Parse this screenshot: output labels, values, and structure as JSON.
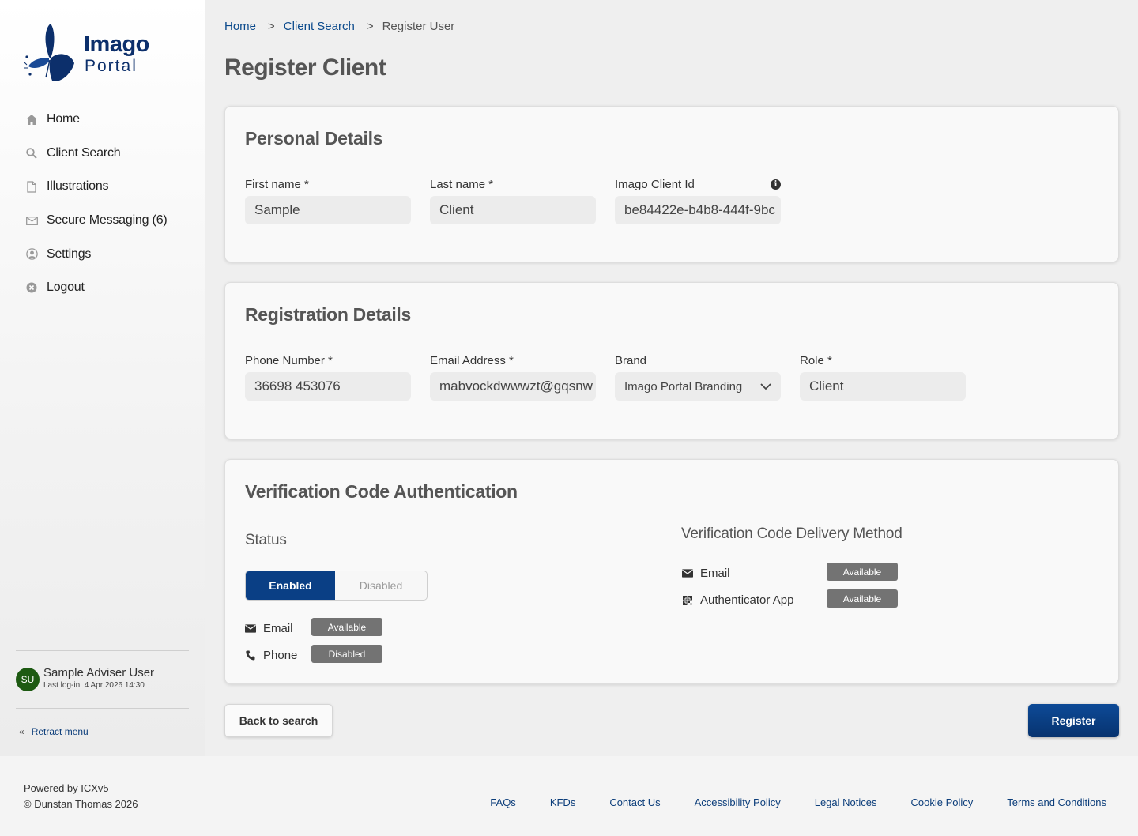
{
  "brand": {
    "name_line1": "Imago",
    "name_line2": "Portal",
    "color": "#0c2f6b"
  },
  "sidebar": {
    "items": [
      {
        "label": "Home",
        "icon": "home-icon"
      },
      {
        "label": "Client Search",
        "icon": "search-icon"
      },
      {
        "label": "Illustrations",
        "icon": "document-icon"
      },
      {
        "label": "Secure Messaging (6)",
        "icon": "envelope-icon"
      },
      {
        "label": "Settings",
        "icon": "user-circle-icon"
      },
      {
        "label": "Logout",
        "icon": "close-circle-icon"
      }
    ],
    "user": {
      "initials": "SU",
      "name": "Sample Adviser User",
      "last_login": "Last log-in: 4 Apr 2026 14:30"
    },
    "retract_label": "Retract menu"
  },
  "breadcrumb": {
    "home": "Home",
    "client_search": "Client Search",
    "current": "Register User",
    "separator": ">"
  },
  "page_title": "Register Client",
  "personal": {
    "title": "Personal Details",
    "first_name": {
      "label": "First name  *",
      "value": "Sample"
    },
    "last_name": {
      "label": "Last name  *",
      "value": "Client"
    },
    "client_id": {
      "label": "Imago Client Id",
      "value": "be84422e-b4b8-444f-9bc"
    }
  },
  "registration": {
    "title": "Registration Details",
    "phone": {
      "label": "Phone Number  *",
      "value": "36698 453076"
    },
    "email": {
      "label": "Email Address  *",
      "value": "mabvockdwwwzt@gqsnw"
    },
    "brand": {
      "label": "Brand",
      "value": "Imago Portal Branding"
    },
    "role": {
      "label": "Role  *",
      "value": "Client"
    }
  },
  "verification": {
    "title": "Verification Code Authentication",
    "status_heading": "Status",
    "toggle": {
      "enabled": "Enabled",
      "disabled": "Disabled",
      "selected": "Enabled"
    },
    "status_methods": [
      {
        "label": "Email",
        "badge": "Available"
      },
      {
        "label": "Phone",
        "badge": "Disabled"
      }
    ],
    "delivery_heading": "Verification Code Delivery Method",
    "delivery_methods": [
      {
        "label": "Email",
        "badge": "Available"
      },
      {
        "label": "Authenticator App",
        "badge": "Available"
      }
    ]
  },
  "actions": {
    "back": "Back to search",
    "register": "Register"
  },
  "footer": {
    "powered": "Powered by ICXv5",
    "copyright": "© Dunstan Thomas 2026",
    "links": [
      "FAQs",
      "KFDs",
      "Contact Us",
      "Accessibility Policy",
      "Legal Notices",
      "Cookie Policy",
      "Terms and Conditions"
    ]
  },
  "colors": {
    "primary": "#0a3f85",
    "link": "#0b4a8c",
    "badge": "#737373",
    "avatar": "#1d5a12"
  }
}
